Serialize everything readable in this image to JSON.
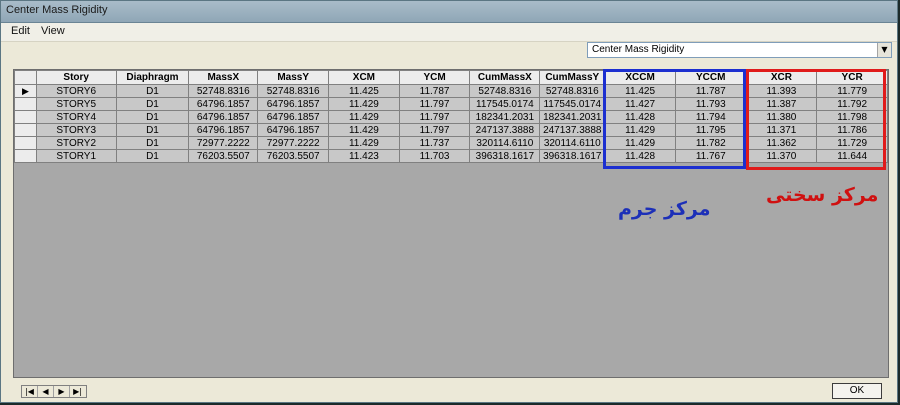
{
  "window": {
    "title": "Center Mass Rigidity"
  },
  "menu": {
    "items": [
      "Edit",
      "View"
    ]
  },
  "combo": {
    "selected": "Center Mass Rigidity"
  },
  "table": {
    "columns": [
      "Story",
      "Diaphragm",
      "MassX",
      "MassY",
      "XCM",
      "YCM",
      "CumMassX",
      "CumMassY",
      "XCCM",
      "YCCM",
      "XCR",
      "YCR"
    ],
    "rows": [
      [
        "STORY6",
        "D1",
        "52748.8316",
        "52748.8316",
        "11.425",
        "11.787",
        "52748.8316",
        "52748.8316",
        "11.425",
        "11.787",
        "11.393",
        "11.779"
      ],
      [
        "STORY5",
        "D1",
        "64796.1857",
        "64796.1857",
        "11.429",
        "11.797",
        "117545.0174",
        "117545.0174",
        "11.427",
        "11.793",
        "11.387",
        "11.792"
      ],
      [
        "STORY4",
        "D1",
        "64796.1857",
        "64796.1857",
        "11.429",
        "11.797",
        "182341.2031",
        "182341.2031",
        "11.428",
        "11.794",
        "11.380",
        "11.798"
      ],
      [
        "STORY3",
        "D1",
        "64796.1857",
        "64796.1857",
        "11.429",
        "11.797",
        "247137.3888",
        "247137.3888",
        "11.429",
        "11.795",
        "11.371",
        "11.786"
      ],
      [
        "STORY2",
        "D1",
        "72977.2222",
        "72977.2222",
        "11.429",
        "11.737",
        "320114.6110",
        "320114.6110",
        "11.429",
        "11.782",
        "11.362",
        "11.729"
      ],
      [
        "STORY1",
        "D1",
        "76203.5507",
        "76203.5507",
        "11.423",
        "11.703",
        "396318.1617",
        "396318.1617",
        "11.428",
        "11.767",
        "11.370",
        "11.644"
      ]
    ],
    "selected_row_index": 0
  },
  "annotations": {
    "blue_label": "مرکز جرم",
    "red_label": "مرکز سختی",
    "blue_color": "#1c2fd0",
    "red_color": "#e01b1b"
  },
  "nav": {
    "first": "first-icon",
    "prev": "prev-icon",
    "next": "next-icon",
    "last": "last-icon"
  },
  "buttons": {
    "ok": "OK"
  }
}
